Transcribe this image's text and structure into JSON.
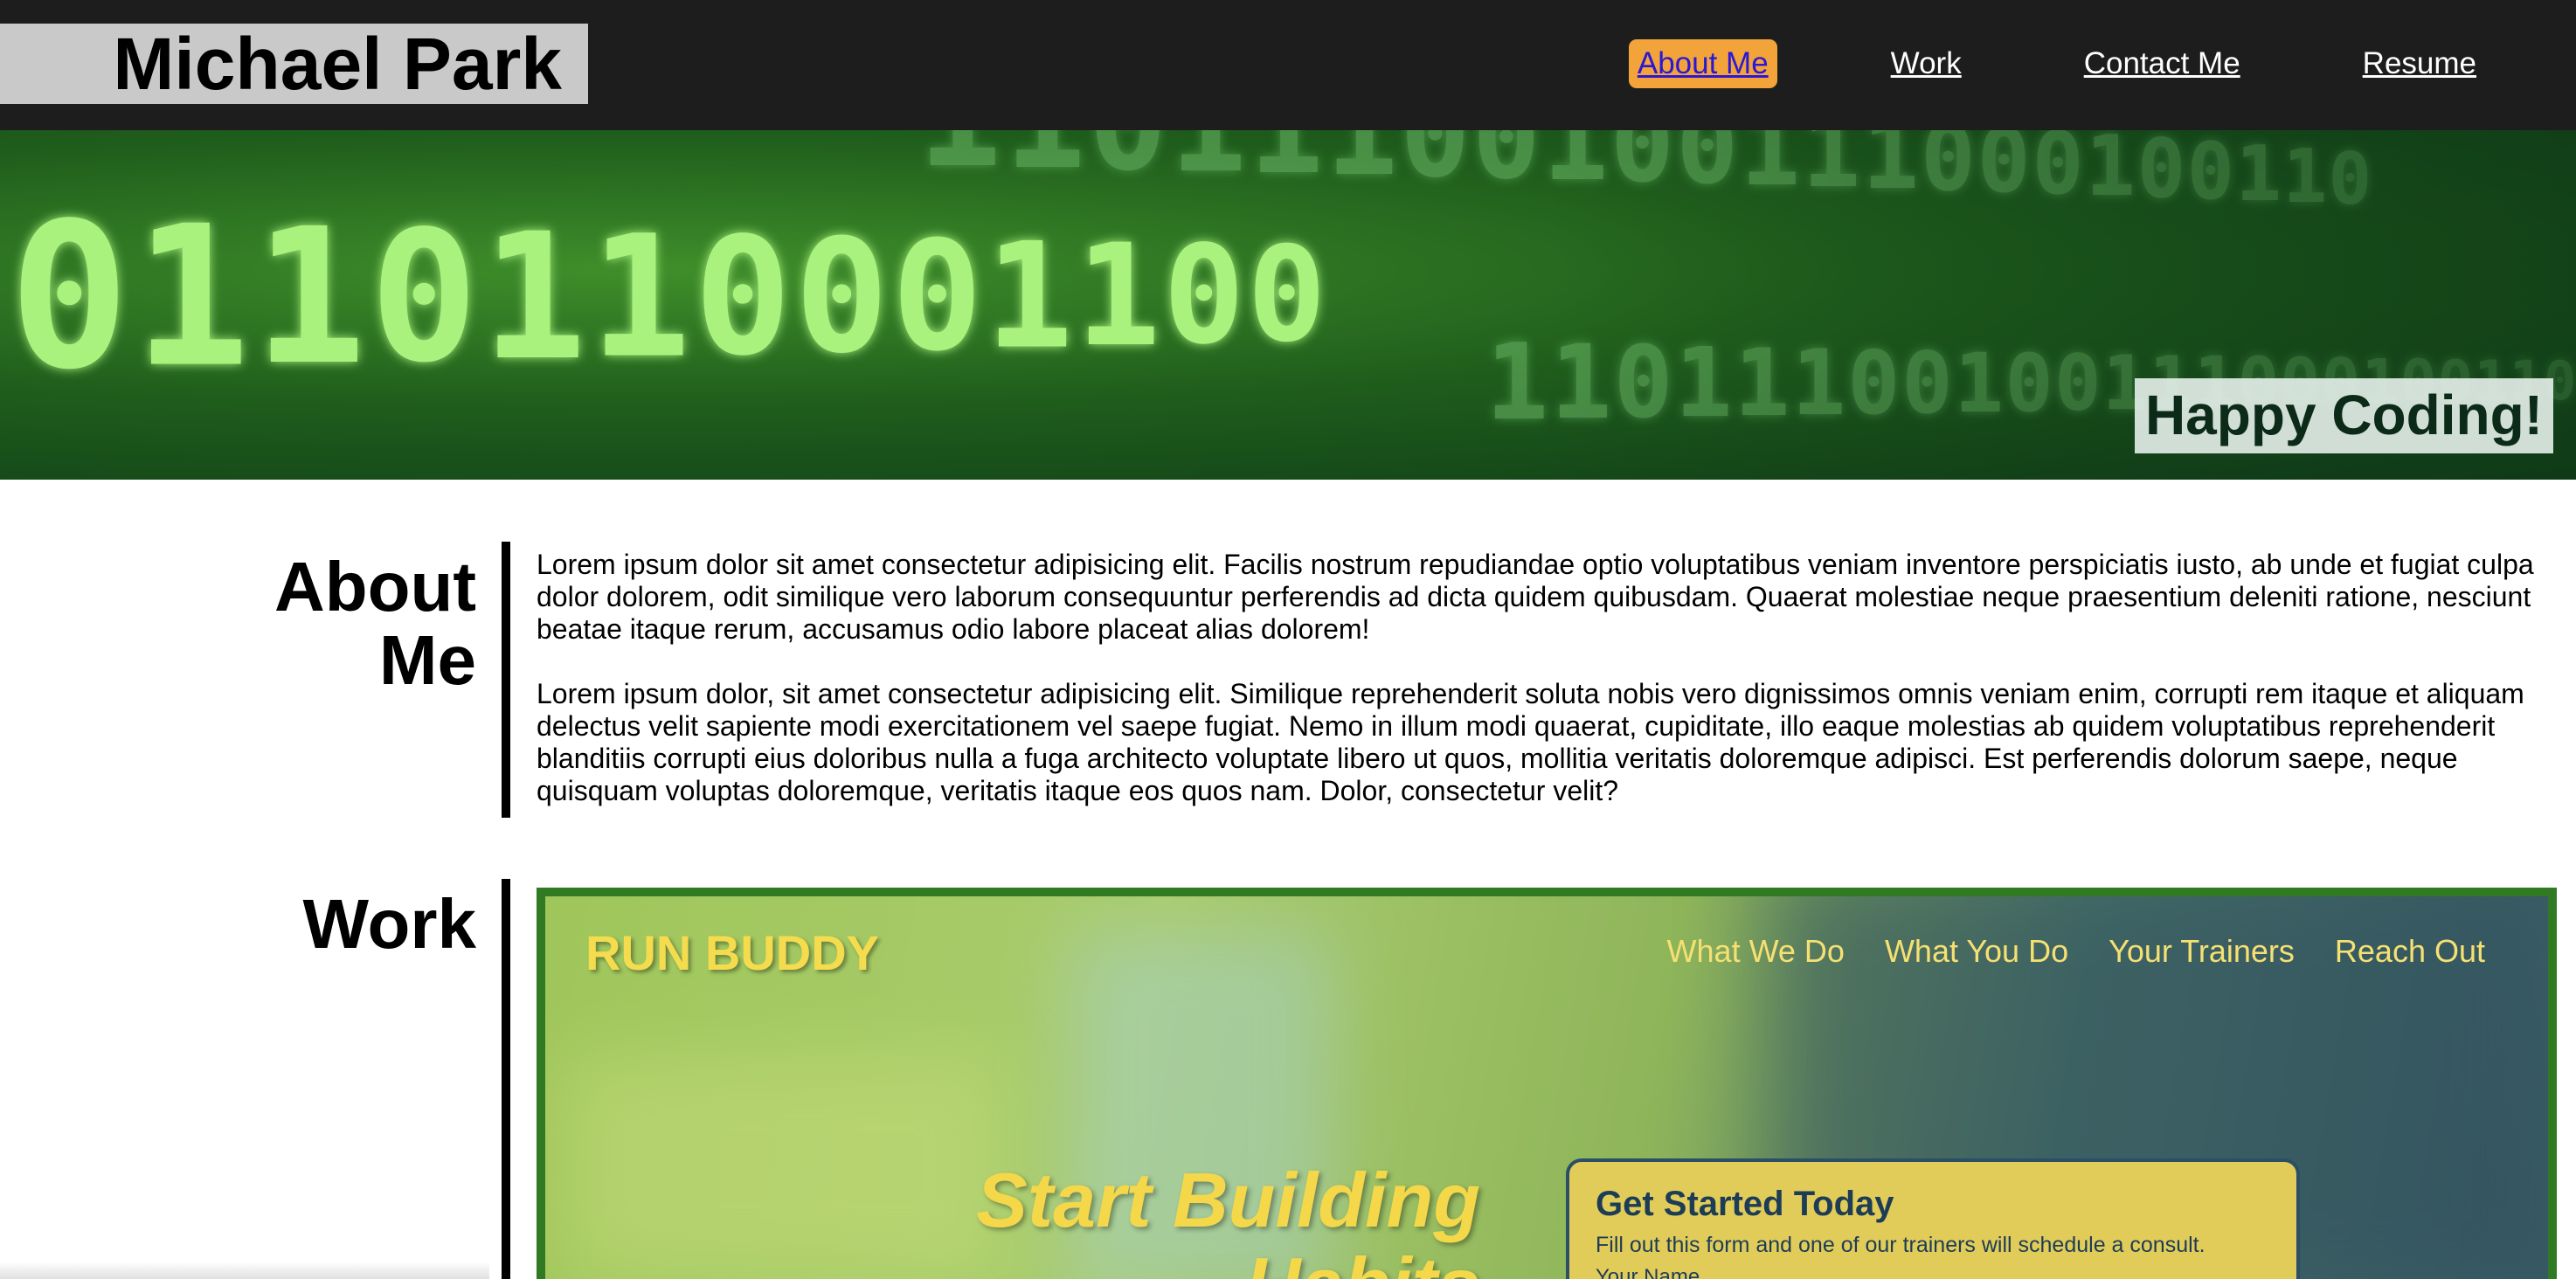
{
  "header": {
    "name": "Michael Park",
    "nav": [
      {
        "label": "About Me",
        "active": true
      },
      {
        "label": "Work",
        "active": false
      },
      {
        "label": "Contact Me",
        "active": false
      },
      {
        "label": "Resume",
        "active": false
      }
    ]
  },
  "hero": {
    "caption": "Happy Coding!",
    "binary_rows": [
      "0110110001100",
      "11011100100111000100110"
    ]
  },
  "about": {
    "heading_line1": "About",
    "heading_line2": "Me",
    "paragraphs": [
      "Lorem ipsum dolor sit amet consectetur adipisicing elit. Facilis nostrum repudiandae optio voluptatibus veniam inventore perspiciatis iusto, ab unde et fugiat culpa dolor dolorem, odit similique vero laborum consequuntur perferendis ad dicta quidem quibusdam. Quaerat molestiae neque praesentium deleniti ratione, nesciunt beatae itaque rerum, accusamus odio labore placeat alias dolorem!",
      "Lorem ipsum dolor, sit amet consectetur adipisicing elit. Similique reprehenderit soluta nobis vero dignissimos omnis veniam enim, corrupti rem itaque et aliquam delectus velit sapiente modi exercitationem vel saepe fugiat. Nemo in illum modi quaerat, cupiditate, illo eaque molestias ab quidem voluptatibus reprehenderit blanditiis corrupti eius doloribus nulla a fuga architecto voluptate libero ut quos, mollitia veritatis doloremque adipisci. Est perferendis dolorum saepe, neque quisquam voluptas doloremque, veritatis itaque eos quos nam. Dolor, consectetur velit?"
    ]
  },
  "work": {
    "heading": "Work",
    "preview": {
      "logo": "RUN BUDDY",
      "nav": [
        "What We Do",
        "What You Do",
        "Your Trainers",
        "Reach Out"
      ],
      "hero_line1": "Start Building",
      "hero_line2": "Habits",
      "form_title": "Get Started Today",
      "form_subtitle": "Fill out this form and one of our trainers will schedule a consult.",
      "form_field_label": "Your Name"
    }
  },
  "colors": {
    "topbar": "#1d1d1d",
    "name_box": "#c9c9c9",
    "active_nav_bg": "#f2a33a",
    "work_border": "#2f7a23",
    "binary_glow": "#9cf08a"
  }
}
